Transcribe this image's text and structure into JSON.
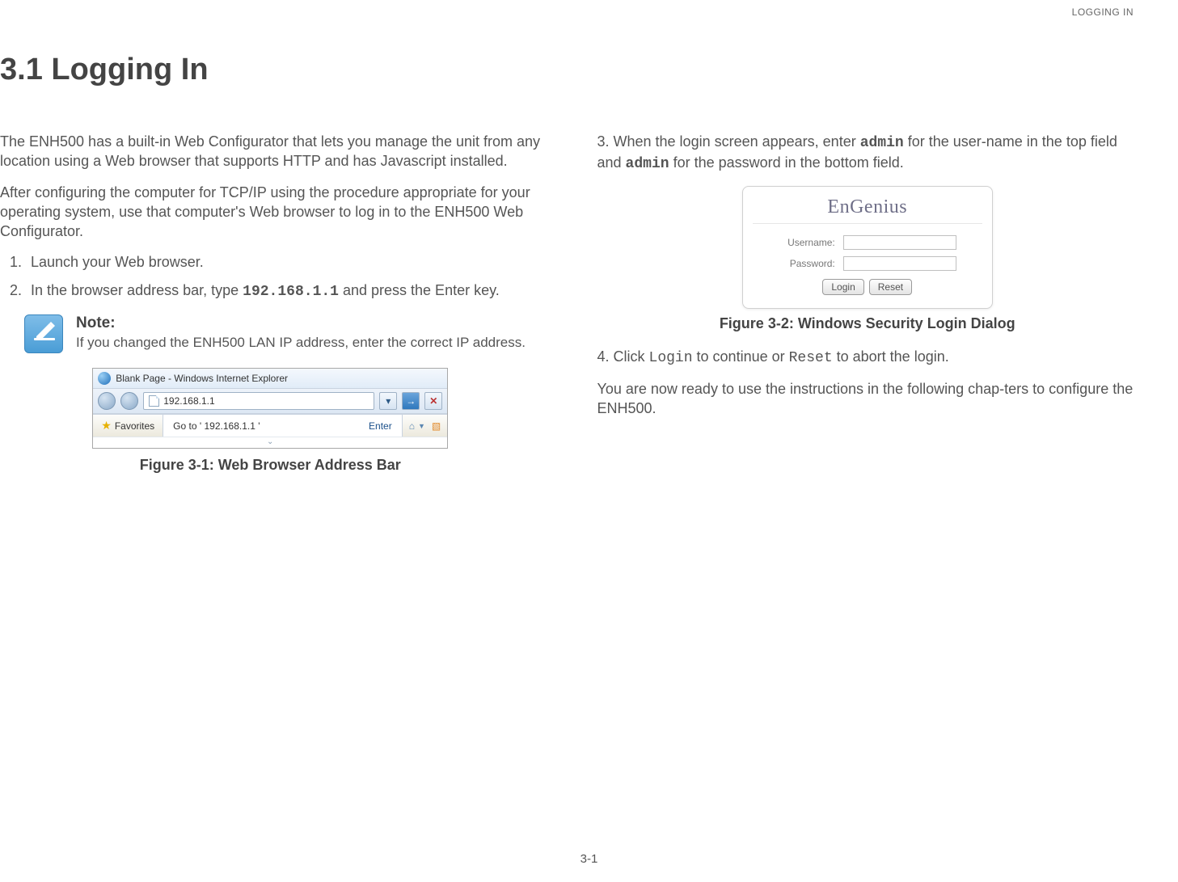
{
  "running_header": "LOGGING IN",
  "section_heading": "3.1 Logging In",
  "left": {
    "p1": "The ENH500 has a built-in Web Configurator that lets you manage the unit from any location using a Web browser that supports HTTP and has Javascript installed.",
    "p2": "After configuring the computer for TCP/IP using the procedure appropriate for your operating system, use that computer's Web browser to log in to the ENH500 Web Configurator.",
    "step1": "Launch your Web browser.",
    "step2_a": "In the browser address bar, type ",
    "step2_code": "192.168.1.1",
    "step2_b": " and press the Enter key.",
    "note_title": "Note:",
    "note_body": "If you changed the ENH500 LAN IP address, enter the correct IP address.",
    "browser_title": "Blank Page - Windows Internet Explorer",
    "browser_addr": "192.168.1.1",
    "browser_goto_a": "Go to ' ",
    "browser_goto_ip": "192.168.1.1",
    "browser_goto_b": " '",
    "browser_favorites": "Favorites",
    "browser_enter": "Enter",
    "fig1_caption": "Figure 3-1: Web Browser Address Bar"
  },
  "right": {
    "p3_a": "3. When the login screen appears, enter ",
    "p3_code1": "admin",
    "p3_b": " for the user-name in the top field and ",
    "p3_code2": "admin",
    "p3_c": " for the password in the bottom field.",
    "login_brand": "EnGenius",
    "login_user_label": "Username:",
    "login_pass_label": "Password:",
    "login_btn": "Login",
    "reset_btn": "Reset",
    "fig2_caption": "Figure 3-2: Windows Security Login Dialog",
    "p4_a": "4. Click ",
    "p4_code1": "Login",
    "p4_b": " to continue or ",
    "p4_code2": "Reset",
    "p4_c": " to abort the login.",
    "p5": "You are now ready to use the instructions in the following chap-ters to configure the ENH500."
  },
  "page_number": "3-1"
}
